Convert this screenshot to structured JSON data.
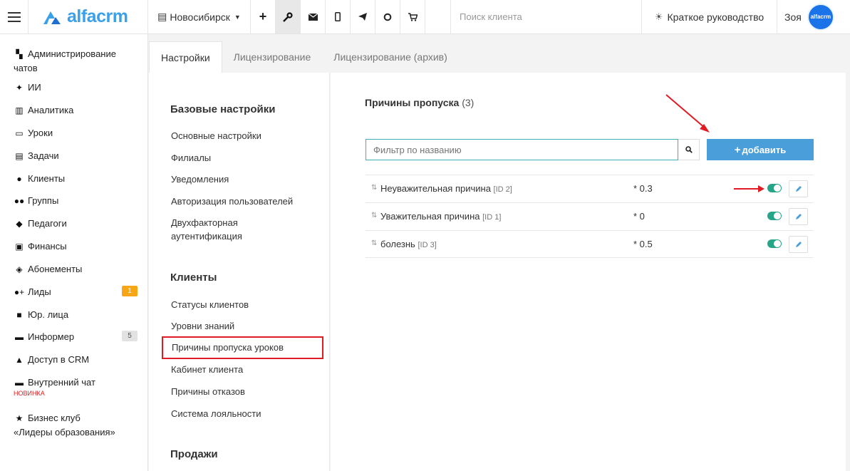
{
  "header": {
    "logo_text": "alfacrm",
    "city": "Новосибирск",
    "search_placeholder": "Поиск клиента",
    "guide_label": "Краткое руководство",
    "user_name": "Зоя",
    "avatar_text": "alfacrm",
    "icons": [
      "plus-icon",
      "wrench-icon",
      "mail-icon",
      "phone-icon",
      "telegram-icon",
      "chat-icon",
      "cart-icon"
    ]
  },
  "sidebar": {
    "items": [
      {
        "label": "Администрирование чатов",
        "icon": "chats-icon"
      },
      {
        "label": "ИИ",
        "icon": "sparkle-icon"
      },
      {
        "label": "Аналитика",
        "icon": "map-icon"
      },
      {
        "label": "Уроки",
        "icon": "calendar-icon"
      },
      {
        "label": "Задачи",
        "icon": "clipboard-icon"
      },
      {
        "label": "Клиенты",
        "icon": "user-icon"
      },
      {
        "label": "Группы",
        "icon": "users-icon"
      },
      {
        "label": "Педагоги",
        "icon": "graduation-cap-icon"
      },
      {
        "label": "Финансы",
        "icon": "money-icon"
      },
      {
        "label": "Абонементы",
        "icon": "tag-icon"
      },
      {
        "label": "Лиды",
        "icon": "user-plus-icon",
        "badge": "1"
      },
      {
        "label": "Юр. лица",
        "icon": "briefcase-icon"
      },
      {
        "label": "Информер",
        "icon": "envelope-icon",
        "badge": "5"
      },
      {
        "label": "Доступ в CRM",
        "icon": "lock-icon"
      },
      {
        "label": "Внутренний чат",
        "icon": "envelope-icon",
        "note": "НОВИНКА"
      },
      {
        "label": "Бизнес клуб «Лидеры образования»",
        "icon": "star-icon"
      }
    ]
  },
  "tabs": [
    {
      "label": "Настройки",
      "active": true
    },
    {
      "label": "Лицензирование",
      "active": false
    },
    {
      "label": "Лицензирование (архив)",
      "active": false
    }
  ],
  "settings_menu": {
    "sections": [
      {
        "heading": "Базовые настройки",
        "items": [
          "Основные настройки",
          "Филиалы",
          "Уведомления",
          "Авторизация пользователей",
          "Двухфакторная аутентификация"
        ]
      },
      {
        "heading": "Клиенты",
        "items": [
          "Статусы клиентов",
          "Уровни знаний",
          "Причины пропуска уроков",
          "Кабинет клиента",
          "Причины отказов",
          "Система лояльности"
        ]
      },
      {
        "heading": "Продажи",
        "items": []
      }
    ],
    "selected": "Причины пропуска уроков"
  },
  "content": {
    "title": "Причины пропуска",
    "count": "(3)",
    "filter_placeholder": "Фильтр по названию",
    "add_label": "добавить",
    "rows": [
      {
        "name": "Неуважительная причина",
        "id": "[ID 2]",
        "coef": "* 0.3",
        "enabled": true
      },
      {
        "name": "Уважительная причина",
        "id": "[ID 1]",
        "coef": "* 0",
        "enabled": true
      },
      {
        "name": "болезнь",
        "id": "[ID 3]",
        "coef": "* 0.5",
        "enabled": true
      }
    ]
  },
  "colors": {
    "accent": "#4a9fda",
    "toggle_on": "#26a689",
    "highlight": "#e01b24",
    "badge_orange": "#f7a616"
  }
}
